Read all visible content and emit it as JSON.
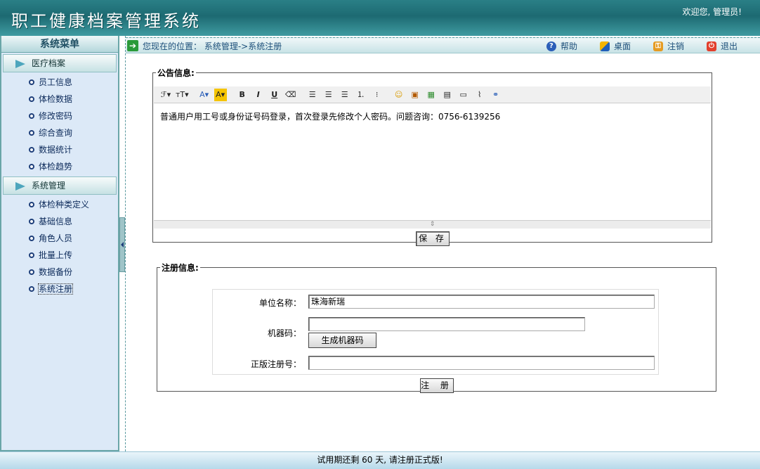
{
  "header": {
    "title": "职工健康档案管理系统",
    "welcome": "欢迎您, 管理员!"
  },
  "sidebar": {
    "title": "系统菜单",
    "sections": [
      {
        "label": "医疗档案",
        "items": [
          "员工信息",
          "体检数据",
          "修改密码",
          "综合查询",
          "数据统计",
          "体检趋势"
        ]
      },
      {
        "label": "系统管理",
        "items": [
          "体检种类定义",
          "基础信息",
          "角色人员",
          "批量上传",
          "数据备份",
          "系统注册"
        ]
      }
    ],
    "active_item": "系统注册"
  },
  "navbar": {
    "location_prefix": "您现在的位置：",
    "location_path": "系统管理->系统注册",
    "links": [
      {
        "label": "帮助",
        "icon": "help-icon"
      },
      {
        "label": "桌面",
        "icon": "desktop-icon"
      },
      {
        "label": "注销",
        "icon": "logout-icon"
      },
      {
        "label": "退出",
        "icon": "exit-icon"
      }
    ]
  },
  "notice": {
    "legend": "公告信息:",
    "content": "普通用户用工号或身份证号码登录，首次登录先修改个人密码。问题咨询：0756-6139256",
    "save_label": "保 存",
    "toolbar": [
      "font-family-icon",
      "font-size-icon",
      "font-color-icon",
      "highlight-icon",
      "bold-icon",
      "italic-icon",
      "underline-icon",
      "eraser-icon",
      "align-left-icon",
      "align-center-icon",
      "align-right-icon",
      "ordered-list-icon",
      "unordered-list-icon",
      "emoticon-icon",
      "image-icon",
      "image-gallery-icon",
      "document-icon",
      "media-icon",
      "attachment-icon",
      "link-icon"
    ]
  },
  "register": {
    "legend": "注册信息:",
    "unit_label": "单位名称：",
    "unit_value": "珠海新瑞",
    "machine_label": "机器码：",
    "machine_value": "",
    "gen_button": "生成机器码",
    "serial_label": "正版注册号：",
    "serial_value": "",
    "submit_label": "注 册"
  },
  "footer": {
    "text": "试用期还剩 60 天, 请注册正式版!"
  },
  "colors": {
    "header_bg": "#1d6a72",
    "sidebar_bg": "#dce9f7",
    "accent": "#4da6bd"
  }
}
